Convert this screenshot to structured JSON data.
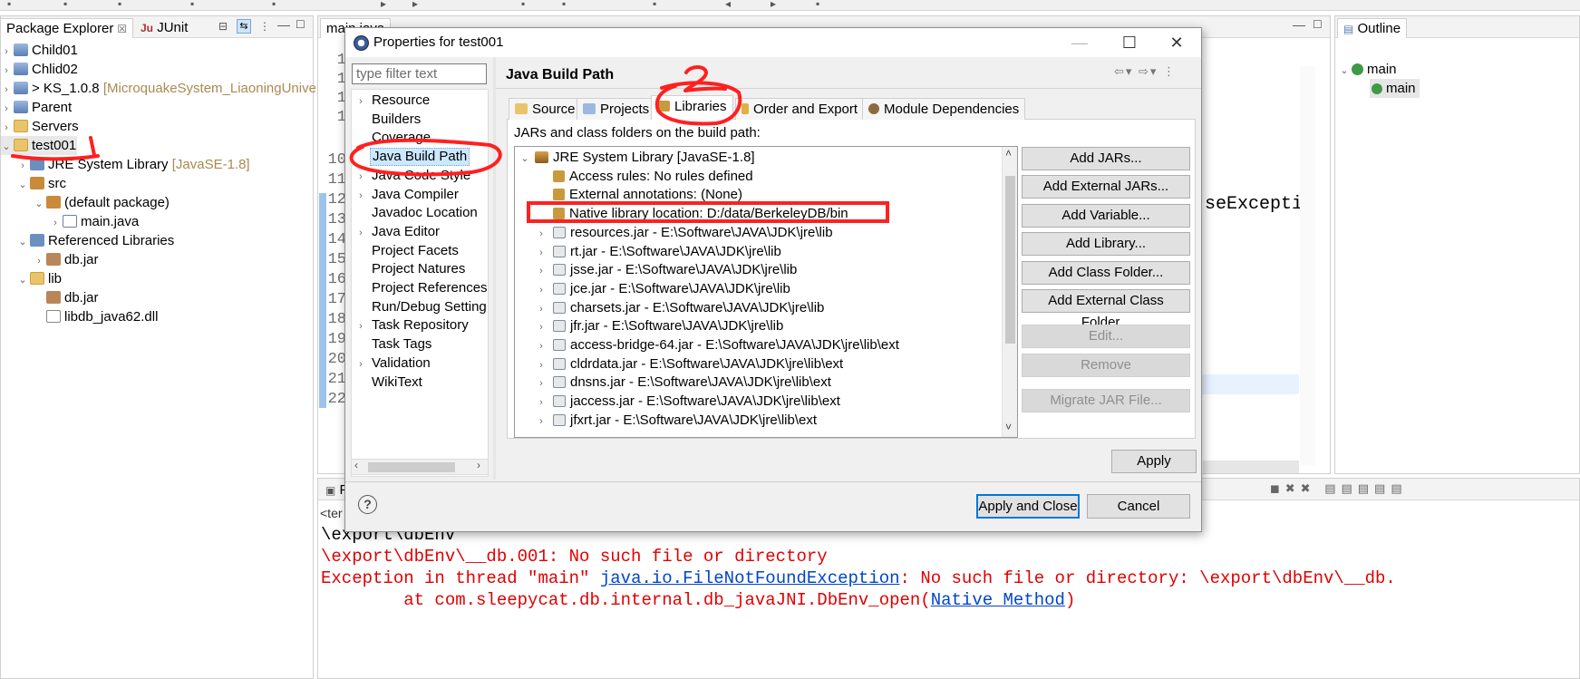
{
  "package_explorer": {
    "tabs": [
      {
        "label": "Package Explorer",
        "close": "☒"
      },
      {
        "label": "JUnit",
        "prefix": "Ju"
      }
    ],
    "items": [
      {
        "label": "Child01",
        "suffix": ""
      },
      {
        "label": "Chlid02",
        "suffix": ""
      },
      {
        "label": "> KS_1.0.8",
        "suffix": "[MicroquakeSystem_LiaoningUnivers"
      },
      {
        "label": "Parent",
        "suffix": ""
      },
      {
        "label": "Servers",
        "suffix": ""
      },
      {
        "label": "test001",
        "suffix": ""
      },
      {
        "label": "JRE System Library",
        "suffix": "[JavaSE-1.8]"
      },
      {
        "label": "src",
        "suffix": ""
      },
      {
        "label": "(default package)",
        "suffix": ""
      },
      {
        "label": "main.java",
        "suffix": ""
      },
      {
        "label": "Referenced Libraries",
        "suffix": ""
      },
      {
        "label": "db.jar",
        "suffix": ""
      },
      {
        "label": "lib",
        "suffix": ""
      },
      {
        "label": "db.jar",
        "suffix": ""
      },
      {
        "label": "libdb_java62.dll",
        "suffix": ""
      }
    ]
  },
  "editor": {
    "tab_label": "main.java",
    "line_numbers": [
      "10",
      "11",
      "12",
      "13",
      "14",
      "15",
      "16",
      "17",
      "18",
      "19",
      "20",
      "21",
      "22"
    ],
    "snippet": "seExceptic",
    "prefix_fragments": [
      "1",
      "1",
      "1",
      "1"
    ]
  },
  "outline": {
    "tab_label": "Outline",
    "items": [
      "main",
      "main"
    ]
  },
  "dialog": {
    "title": "Properties for test001",
    "filter_placeholder": "type filter text",
    "nav_items": [
      {
        "label": "Resource",
        "expandable": true
      },
      {
        "label": "Builders",
        "expandable": false
      },
      {
        "label": "Coverage",
        "expandable": false
      },
      {
        "label": "Java Build Path",
        "expandable": false,
        "selected": true
      },
      {
        "label": "Java Code Style",
        "expandable": true
      },
      {
        "label": "Java Compiler",
        "expandable": true
      },
      {
        "label": "Javadoc Location",
        "expandable": false
      },
      {
        "label": "Java Editor",
        "expandable": true
      },
      {
        "label": "Project Facets",
        "expandable": false
      },
      {
        "label": "Project Natures",
        "expandable": false
      },
      {
        "label": "Project References",
        "expandable": false
      },
      {
        "label": "Run/Debug Setting",
        "expandable": false
      },
      {
        "label": "Task Repository",
        "expandable": true
      },
      {
        "label": "Task Tags",
        "expandable": false
      },
      {
        "label": "Validation",
        "expandable": true
      },
      {
        "label": "WikiText",
        "expandable": false
      }
    ],
    "page_title": "Java Build Path",
    "tabs": [
      "Source",
      "Projects",
      "Libraries",
      "Order and Export",
      "Module Dependencies"
    ],
    "active_tab": "Libraries",
    "classpath_label": "JARs and class folders on the build path:",
    "library_rows": [
      {
        "label": "JRE System Library [JavaSE-1.8]",
        "level": 0,
        "twisty": "v",
        "icon": "jre"
      },
      {
        "label": "Access rules: No rules defined",
        "level": 1,
        "twisty": "",
        "icon": "attr"
      },
      {
        "label": "External annotations: (None)",
        "level": 1,
        "twisty": "",
        "icon": "attr"
      },
      {
        "label": "Native library location: D:/data/BerkeleyDB/bin",
        "level": 1,
        "twisty": "",
        "icon": "attr"
      },
      {
        "label": "resources.jar - E:\\Software\\JAVA\\JDK\\jre\\lib",
        "level": 1,
        "twisty": ">",
        "icon": "jar"
      },
      {
        "label": "rt.jar - E:\\Software\\JAVA\\JDK\\jre\\lib",
        "level": 1,
        "twisty": ">",
        "icon": "jar"
      },
      {
        "label": "jsse.jar - E:\\Software\\JAVA\\JDK\\jre\\lib",
        "level": 1,
        "twisty": ">",
        "icon": "jar"
      },
      {
        "label": "jce.jar - E:\\Software\\JAVA\\JDK\\jre\\lib",
        "level": 1,
        "twisty": ">",
        "icon": "jar"
      },
      {
        "label": "charsets.jar - E:\\Software\\JAVA\\JDK\\jre\\lib",
        "level": 1,
        "twisty": ">",
        "icon": "jar"
      },
      {
        "label": "jfr.jar - E:\\Software\\JAVA\\JDK\\jre\\lib",
        "level": 1,
        "twisty": ">",
        "icon": "jar"
      },
      {
        "label": "access-bridge-64.jar - E:\\Software\\JAVA\\JDK\\jre\\lib\\ext",
        "level": 1,
        "twisty": ">",
        "icon": "jar"
      },
      {
        "label": "cldrdata.jar - E:\\Software\\JAVA\\JDK\\jre\\lib\\ext",
        "level": 1,
        "twisty": ">",
        "icon": "jar"
      },
      {
        "label": "dnsns.jar - E:\\Software\\JAVA\\JDK\\jre\\lib\\ext",
        "level": 1,
        "twisty": ">",
        "icon": "jar"
      },
      {
        "label": "jaccess.jar - E:\\Software\\JAVA\\JDK\\jre\\lib\\ext",
        "level": 1,
        "twisty": ">",
        "icon": "jar"
      },
      {
        "label": "jfxrt.jar - E:\\Software\\JAVA\\JDK\\jre\\lib\\ext",
        "level": 1,
        "twisty": ">",
        "icon": "jar"
      }
    ],
    "buttons": [
      {
        "label": "Add JARs...",
        "enabled": true
      },
      {
        "label": "Add External JARs...",
        "enabled": true
      },
      {
        "label": "Add Variable...",
        "enabled": true
      },
      {
        "label": "Add Library...",
        "enabled": true
      },
      {
        "label": "Add Class Folder...",
        "enabled": true
      },
      {
        "label": "Add External Class Folder...",
        "enabled": true
      },
      {
        "label": "Edit...",
        "enabled": false
      },
      {
        "label": "Remove",
        "enabled": false
      },
      {
        "label": "Migrate JAR File...",
        "enabled": false
      }
    ],
    "apply_label": "Apply",
    "help_label": "?",
    "apply_close_label": "Apply and Close",
    "cancel_label": "Cancel",
    "win_minimize": "—",
    "win_maximize": "☐",
    "win_close": "✕"
  },
  "console": {
    "tab_fragment": "P",
    "terminated_fragment": "<ter",
    "lines": [
      {
        "text": "\\export\\dbEnv",
        "style": "normal"
      },
      {
        "text": "\\export\\dbEnv\\__db.001: No such file or directory",
        "style": "error"
      }
    ],
    "exception": {
      "prefix": "Exception in thread \"main\" ",
      "link": "java.io.FileNotFoundException",
      "suffix": ": No such file or directory: \\export\\dbEnv\\__db."
    },
    "stack": {
      "prefix": "        at com.sleepycat.db.internal.db_javaJNI.DbEnv_open(",
      "link": "Native Method",
      "suffix": ")"
    }
  },
  "colors": {
    "annotation_red": "#ff2020",
    "error_text": "#e00000",
    "link": "#0044cc",
    "selection": "#cce8ff",
    "default_button_border": "#0078d7"
  }
}
